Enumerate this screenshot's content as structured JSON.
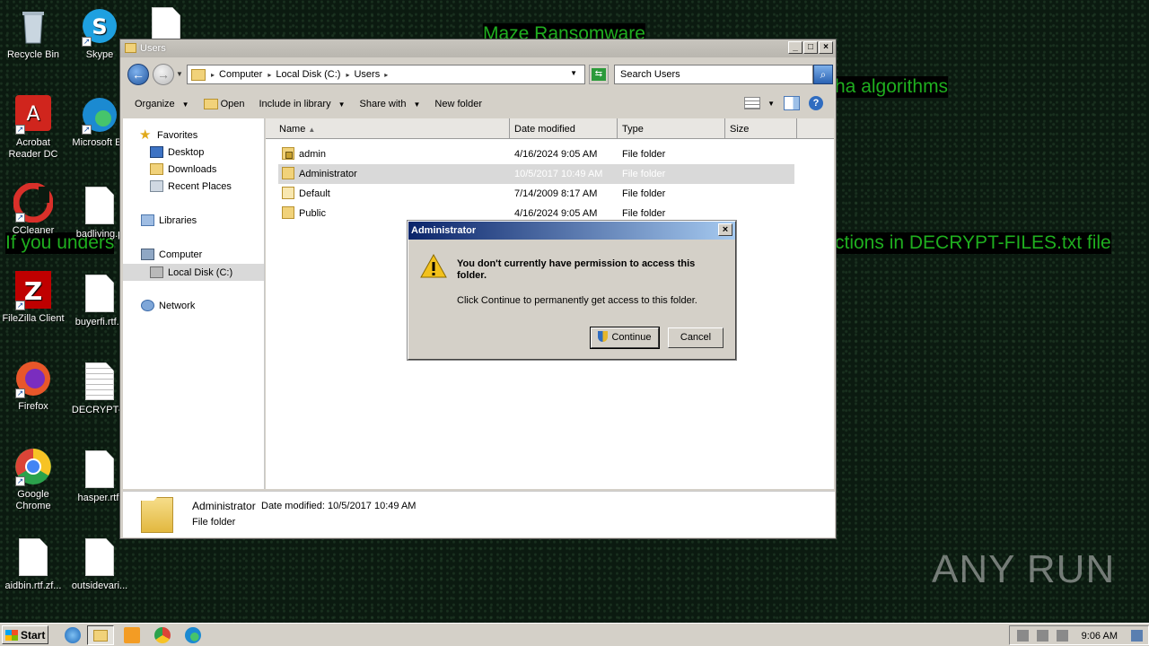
{
  "wallpaper": {
    "title": "Maze Ransomware",
    "line_algorithms": "ha algorithms",
    "line_left": "If you unders",
    "line_right": "ctions in DECRYPT-FILES.txt file"
  },
  "desktop_icons": [
    {
      "label": "Recycle Bin"
    },
    {
      "label": "Skype"
    },
    {
      "label": "Acrobat Reader DC"
    },
    {
      "label": "Microsoft Ed"
    },
    {
      "label": "CCleaner"
    },
    {
      "label": "badliving.p"
    },
    {
      "label": "FileZilla Client"
    },
    {
      "label": "buyerfi.rtf.c"
    },
    {
      "label": "Firefox"
    },
    {
      "label": "DECRYPT-F"
    },
    {
      "label": "Google Chrome"
    },
    {
      "label": "hasper.rtf."
    },
    {
      "label": "aidbin.rtf.zf..."
    },
    {
      "label": "outsidevari..."
    }
  ],
  "explorer": {
    "title": "Users",
    "breadcrumb": [
      "Computer",
      "Local Disk (C:)",
      "Users"
    ],
    "search_placeholder": "Search Users",
    "toolbar": {
      "organize": "Organize",
      "open": "Open",
      "include_in_library": "Include in library",
      "share_with": "Share with",
      "new_folder": "New folder"
    },
    "nav": {
      "favorites": "Favorites",
      "desktop": "Desktop",
      "downloads": "Downloads",
      "recent_places": "Recent Places",
      "libraries": "Libraries",
      "computer": "Computer",
      "local_disk": "Local Disk (C:)",
      "network": "Network"
    },
    "columns": [
      "Name",
      "Date modified",
      "Type",
      "Size"
    ],
    "rows": [
      {
        "name": "admin",
        "date": "4/16/2024 9:05 AM",
        "type": "File folder"
      },
      {
        "name": "Administrator",
        "date": "10/5/2017 10:49 AM",
        "type": "File folder"
      },
      {
        "name": "Default",
        "date": "7/14/2009 8:17 AM",
        "type": "File folder"
      },
      {
        "name": "Public",
        "date": "4/16/2024 9:05 AM",
        "type": "File folder"
      }
    ],
    "details": {
      "name": "Administrator",
      "date": "Date modified: 10/5/2017 10:49 AM",
      "type": "File folder"
    }
  },
  "dialog": {
    "title": "Administrator",
    "heading": "You don't currently have permission to access this folder.",
    "body": "Click Continue to permanently get access to this folder.",
    "continue": "Continue",
    "cancel": "Cancel"
  },
  "taskbar": {
    "start": "Start",
    "clock": "9:06 AM"
  },
  "watermark": "ANY RUN"
}
